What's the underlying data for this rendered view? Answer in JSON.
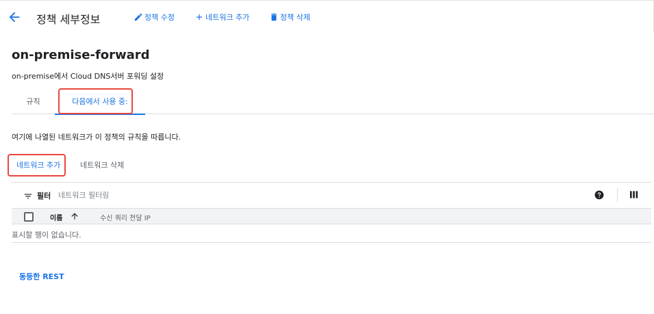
{
  "header": {
    "title": "정책 세부정보",
    "edit_label": "정책 수정",
    "add_network_label": "네트워크 추가",
    "delete_label": "정책 삭제"
  },
  "policy": {
    "name": "on-premise-forward",
    "description": "on-premise에서 Cloud DNS서버 포워딩 설정"
  },
  "tabs": [
    {
      "label": "규칙",
      "active": false
    },
    {
      "label": "다음에서 사용 중:",
      "active": true
    }
  ],
  "info_text": "여기에 나열된 네트워크가 이 정책의 규칙을 따릅니다.",
  "actions": {
    "add_label": "네트워크 추가",
    "delete_label": "네트워크 삭제"
  },
  "filter": {
    "label": "필터",
    "placeholder": "네트워크 필터링"
  },
  "table": {
    "columns": [
      "이름",
      "수신 쿼리 전달 IP"
    ],
    "empty_text": "표시할 행이 없습니다."
  },
  "footer": {
    "rest_label": "동등한 REST"
  },
  "colors": {
    "accent": "#1a73e8",
    "highlight": "#e8453c"
  }
}
